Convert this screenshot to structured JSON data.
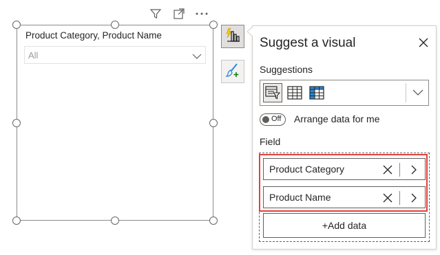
{
  "visual_header": {
    "icons": [
      "filter-icon",
      "focus-mode-icon",
      "more-options-icon"
    ]
  },
  "slicer": {
    "title": "Product Category, Product Name",
    "dropdown_value": "All"
  },
  "side_toolbar": {
    "buttons": [
      "suggest-visual-icon",
      "format-brush-icon"
    ]
  },
  "panel": {
    "title": "Suggest a visual",
    "suggestions_label": "Suggestions",
    "suggestion_icons": [
      "slicer-icon",
      "table-icon",
      "matrix-icon"
    ],
    "arrange_toggle_state": "Off",
    "arrange_label": "Arrange data for me",
    "field_label": "Field",
    "fields": [
      {
        "name": "Product Category"
      },
      {
        "name": "Product Name"
      }
    ],
    "add_data_label": "+Add data"
  },
  "colors": {
    "highlight": "#e0403c",
    "accent_yellow": "#f2c811",
    "table_blue": "#2b88d8"
  }
}
